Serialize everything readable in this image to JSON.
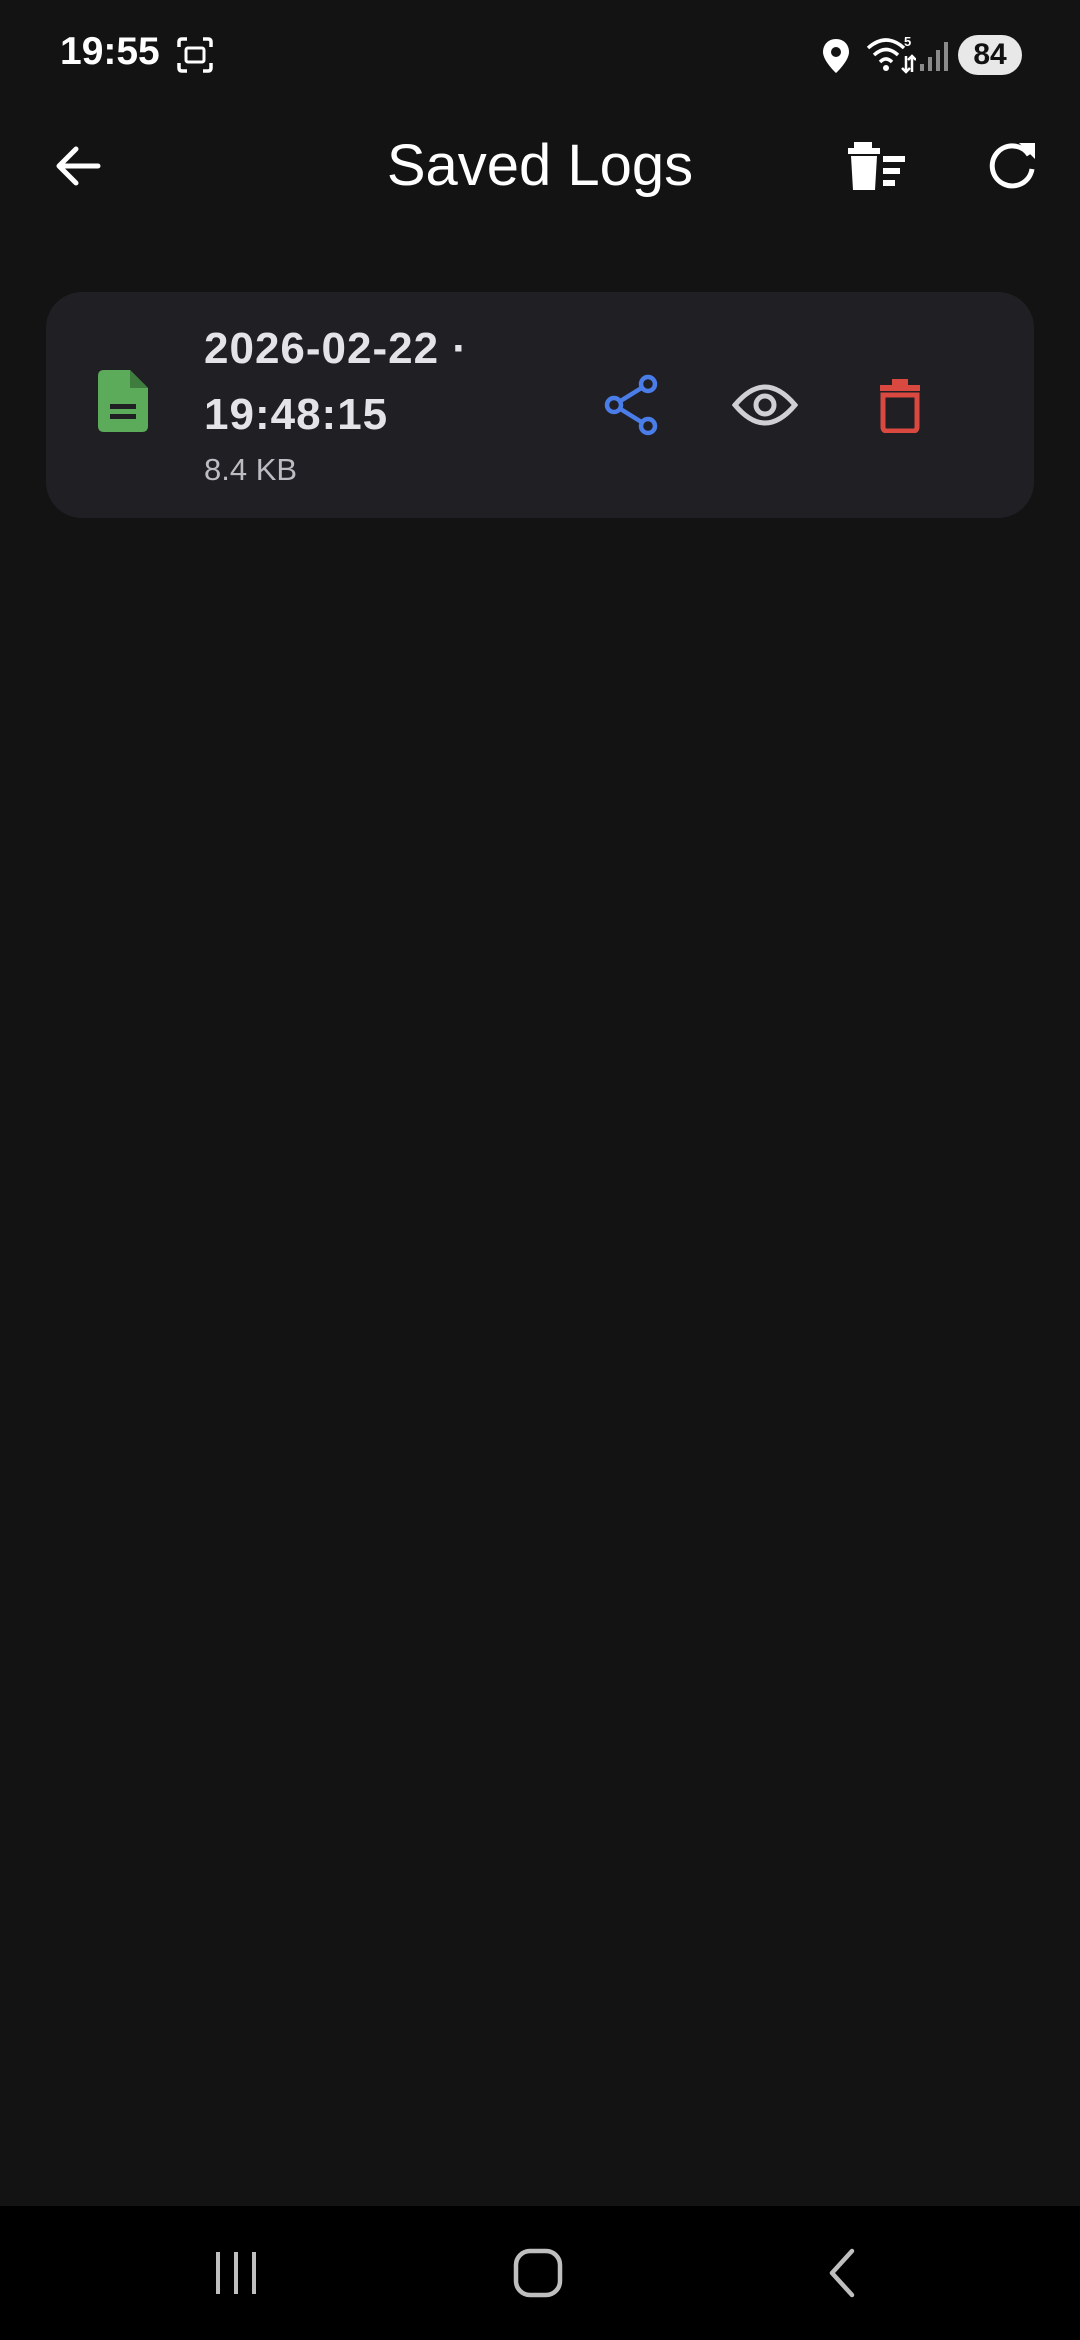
{
  "status_bar": {
    "time": "19:55",
    "battery": "84",
    "network_badge": "5"
  },
  "app_bar": {
    "title": "Saved Logs",
    "icons": [
      "back-arrow-icon",
      "delete-all-icon",
      "refresh-icon"
    ]
  },
  "logs": [
    {
      "title": "2026-02-22 · 19:48:15",
      "size": "8.4 KB",
      "icon": "file-document-icon",
      "actions": [
        "share-icon",
        "eye-icon",
        "trash-icon"
      ]
    }
  ],
  "colors": {
    "background": "#131313",
    "card": "#201f24",
    "file_icon": "#5cab5a",
    "share": "#4a7de8",
    "view": "#cfcfd4",
    "delete": "#d9493f"
  },
  "nav_bar": {
    "icons": [
      "recents-icon",
      "home-icon",
      "back-icon"
    ]
  }
}
